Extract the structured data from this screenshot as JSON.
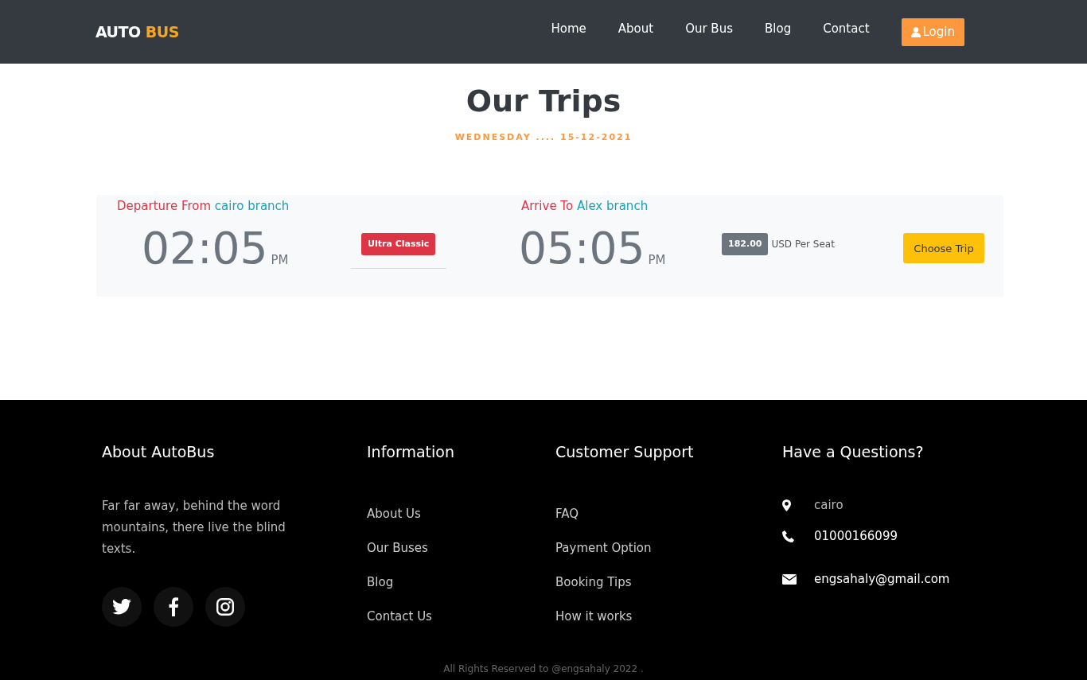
{
  "header": {
    "logo": {
      "part_1": "AUTO",
      "part_2": "BUS"
    },
    "nav": [
      {
        "label": "Home"
      },
      {
        "label": "About"
      },
      {
        "label": "Our Bus"
      },
      {
        "label": "Blog"
      },
      {
        "label": "Contact"
      }
    ],
    "login_button": "Login"
  },
  "page": {
    "title": "Our Trips",
    "date": "WEDNESDAY .... 15-12-2021"
  },
  "trips": [
    {
      "departure": {
        "label": "Departure From",
        "place": "cairo branch",
        "time": "02:05",
        "period": "PM"
      },
      "class_badge": "Ultra Classic",
      "arrival": {
        "label": "Arrive To",
        "place": "Alex branch",
        "time": "05:05",
        "period": "PM"
      },
      "price": "182.00",
      "price_unit": "USD Per Seat",
      "button": "Choose Trip"
    }
  ],
  "footer": {
    "columns": [
      {
        "kind": "about",
        "title": "About AutoBus",
        "text": "Far far away, behind the word mountains, there live the blind texts.",
        "social": [
          {
            "kind": "bird"
          },
          {
            "kind": "f"
          },
          {
            "kind": "camera"
          }
        ]
      },
      {
        "kind": "links",
        "title": "Information",
        "links": [
          "About Us",
          "Our Buses",
          "Blog",
          "Contact Us"
        ]
      },
      {
        "kind": "links",
        "title": "Customer Support",
        "links": [
          "FAQ",
          "Payment Option",
          "Booking Tips",
          "How it works"
        ]
      },
      {
        "kind": "contact",
        "title": "Have a Questions?",
        "items": [
          {
            "kind": "pin",
            "text": "cairo"
          },
          {
            "kind": "phone",
            "text": "01000166099"
          },
          {
            "kind": "mail",
            "text": "engsahaly@gmail.com"
          }
        ]
      }
    ],
    "copyright": "All Rights Reserved to @engsahaly 2022 ."
  }
}
